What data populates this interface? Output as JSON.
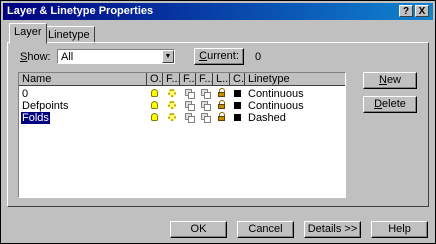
{
  "window": {
    "title": "Layer & Linetype Properties",
    "help_glyph": "?",
    "close_glyph": "X"
  },
  "tabs": [
    {
      "label": "Layer",
      "active": true
    },
    {
      "label": "Linetype",
      "active": false
    }
  ],
  "show": {
    "label_mn": "S",
    "label_rest": "how:",
    "value": "All"
  },
  "current": {
    "button_mn": "C",
    "button_rest": "urrent:",
    "value": "0"
  },
  "table": {
    "headers": [
      "Name",
      "O...",
      "F...",
      "F...",
      "F...",
      "L...",
      "C...",
      "Linetype"
    ],
    "rows": [
      {
        "name": "0",
        "linetype": "Continuous",
        "selected": false
      },
      {
        "name": "Defpoints",
        "linetype": "Continuous",
        "selected": false
      },
      {
        "name": "Folds",
        "linetype": "Dashed",
        "selected": true
      }
    ]
  },
  "side_buttons": {
    "new_mn": "N",
    "new_rest": "ew",
    "delete_mn": "D",
    "delete_rest": "elete"
  },
  "footer": {
    "ok": "OK",
    "cancel": "Cancel",
    "details": "Details >>",
    "help": "Help"
  },
  "colors": {
    "title_start": "#000080",
    "title_end": "#1084d0",
    "face": "#c0c0c0",
    "selection": "#000080"
  }
}
